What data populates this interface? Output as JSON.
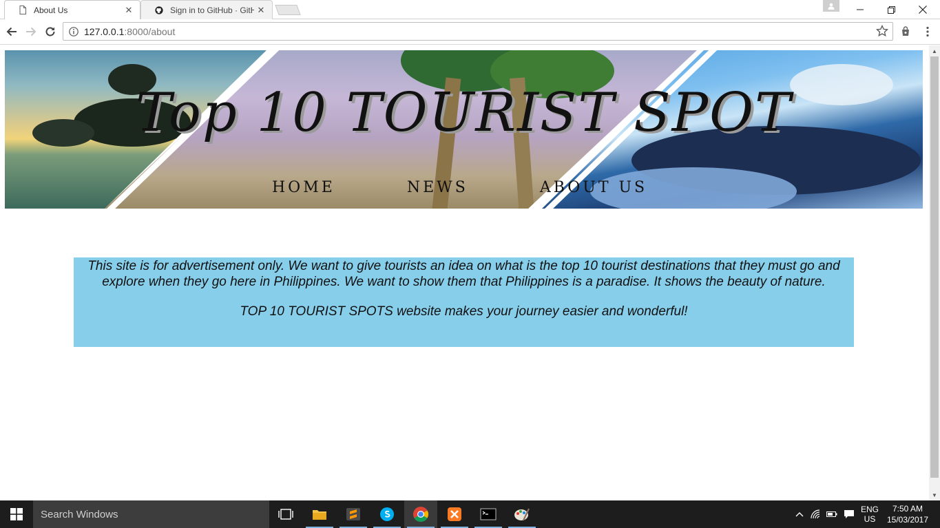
{
  "browser": {
    "tabs": [
      {
        "title": "About Us",
        "active": true,
        "icon": "page-icon"
      },
      {
        "title": "Sign in to GitHub · GitHub",
        "active": false,
        "icon": "github-icon"
      }
    ],
    "address": {
      "host": "127.0.0.1",
      "path": ":8000/about"
    }
  },
  "page": {
    "banner": {
      "title": "Top 10 TOURIST SPOT",
      "nav": [
        {
          "label": "HOME"
        },
        {
          "label": "NEWS"
        },
        {
          "label": "ABOUT US"
        }
      ]
    },
    "about": {
      "paragraph1": "This site is for advertisement only. We want to give tourists an idea on what is the top 10 tourist destinations that they must go and explore when they go here in Philippines. We want to show them that Philippines is a paradise. It shows the beauty of nature.",
      "paragraph2": "TOP 10 TOURIST SPOTS website makes your journey easier and wonderful!",
      "background_color": "#87ceeb"
    }
  },
  "taskbar": {
    "search_placeholder": "Search Windows",
    "apps": [
      "task-view-icon",
      "file-explorer-icon",
      "sublime-text-icon",
      "skype-icon",
      "chrome-icon",
      "xampp-icon",
      "command-prompt-icon",
      "paint-icon"
    ],
    "language": {
      "line1": "ENG",
      "line2": "US"
    },
    "clock": {
      "time": "7:50 AM",
      "date": "15/03/2017"
    }
  }
}
